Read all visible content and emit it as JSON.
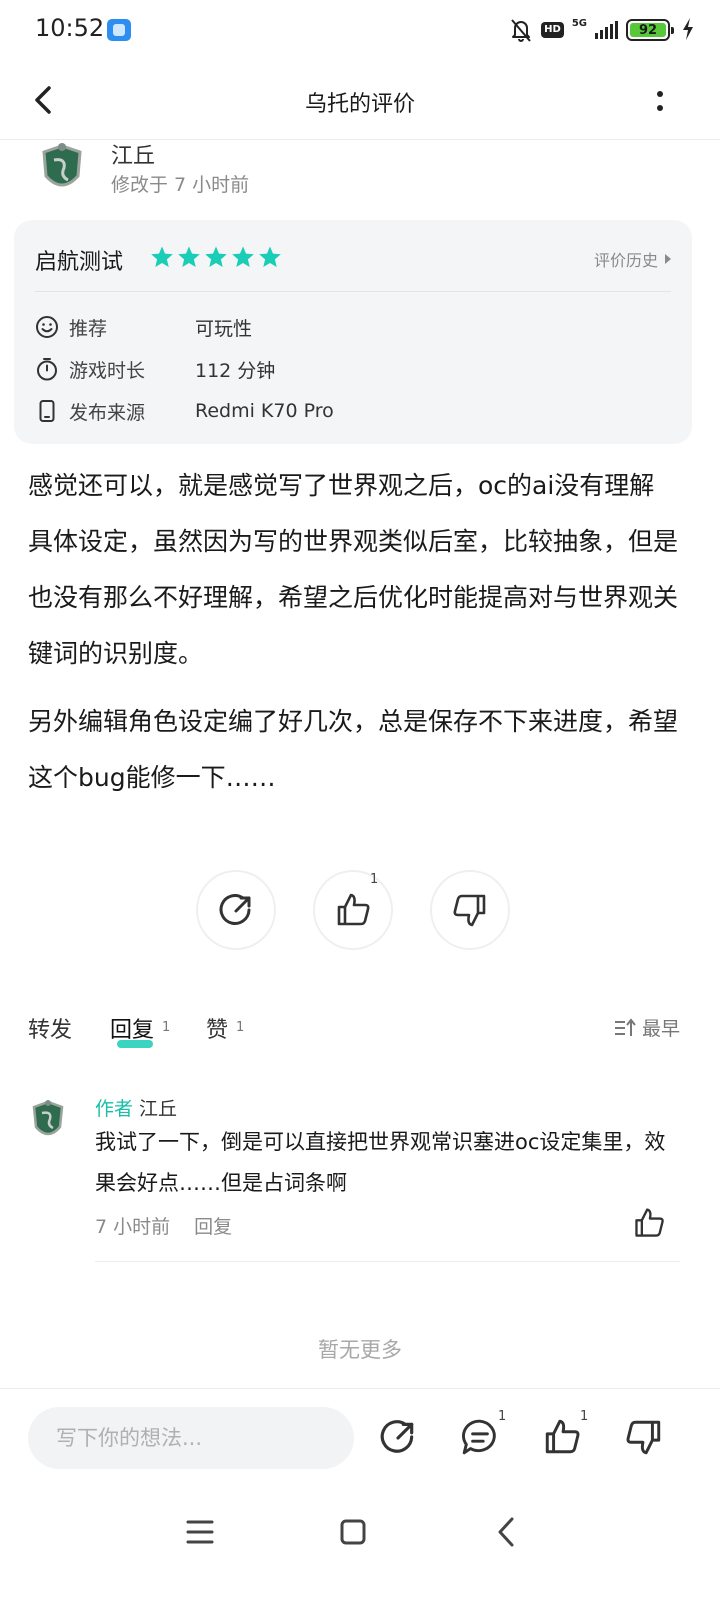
{
  "status_bar": {
    "time": "10:52",
    "network": "5G",
    "hd_badge": "HD",
    "battery": "92"
  },
  "top_bar": {
    "title": "乌托的评价"
  },
  "author": {
    "name": "江丘",
    "meta": "修改于 7 小时前"
  },
  "review_card": {
    "label": "启航测试",
    "stars": 5,
    "star_color": "#19cdb6",
    "history_link": "评价历史",
    "rows": [
      {
        "key": "推荐",
        "value": "可玩性",
        "icon": "smile-icon"
      },
      {
        "key": "游戏时长",
        "value": "112 分钟",
        "icon": "timer-icon"
      },
      {
        "key": "发布来源",
        "value": "Redmi  K70 Pro",
        "icon": "phone-icon"
      }
    ]
  },
  "review_body": {
    "paragraph_1": "感觉还可以，就是感觉写了世界观之后，oc的ai没有理解具体设定，虽然因为写的世界观类似后室，比较抽象，但是也没有那么不好理解，希望之后优化时能提高对与世界观关键词的识别度。",
    "paragraph_2": "另外编辑角色设定编了好几次，总是保存不下来进度，希望这个bug能修一下……"
  },
  "actions": {
    "like_count": "1"
  },
  "tabs": {
    "forward_label": "转发",
    "reply_label": "回复",
    "reply_count": "1",
    "like_label": "赞",
    "like_count": "1",
    "sort_label": "最早"
  },
  "comment": {
    "author_tag": "作者",
    "name": "江丘",
    "text": "我试了一下，倒是可以直接把世界观常识塞进oc设定集里，效果会好点……但是占词条啊",
    "time": "7 小时前",
    "reply_label": "回复"
  },
  "no_more": "暂无更多",
  "bottom_bar": {
    "input_placeholder": "写下你的想法...",
    "comment_count": "1",
    "like_count": "1"
  },
  "colors": {
    "accent": "#19cdb6"
  }
}
